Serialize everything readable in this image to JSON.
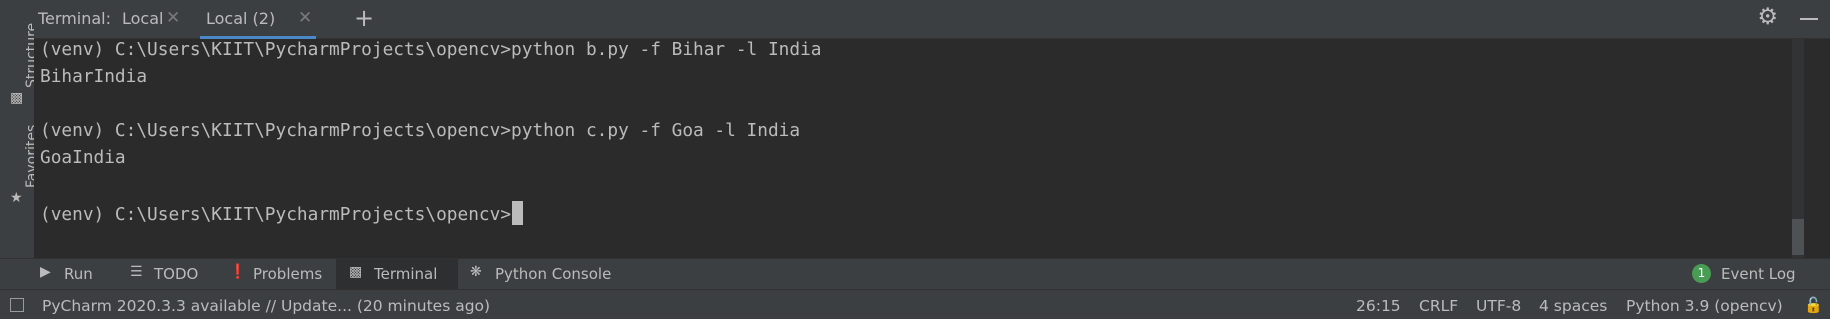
{
  "left_sidebar": {
    "structure_label": "Structure",
    "favorites_label": "Favorites"
  },
  "tab_bar": {
    "title": "Terminal:",
    "tabs": [
      {
        "label": "Local",
        "active": false
      },
      {
        "label": "Local (2)",
        "active": true
      }
    ],
    "add_tab": "+"
  },
  "terminal": {
    "lines": [
      "(venv) C:\\Users\\KIIT\\PycharmProjects\\opencv>python b.py -f Bihar -l India",
      "BiharIndia",
      "",
      "(venv) C:\\Users\\KIIT\\PycharmProjects\\opencv>python c.py -f Goa -l India",
      "GoaIndia",
      "",
      "(venv) C:\\Users\\KIIT\\PycharmProjects\\opencv>"
    ]
  },
  "tool_windows": {
    "tabs": [
      {
        "label": "Run",
        "icon": "play-icon"
      },
      {
        "label": "TODO",
        "icon": "list-icon"
      },
      {
        "label": "Problems",
        "icon": "info-icon"
      },
      {
        "label": "Terminal",
        "icon": "terminal-icon",
        "active": true
      },
      {
        "label": "Python Console",
        "icon": "python-icon"
      }
    ],
    "event_log": {
      "label": "Event Log",
      "count": "1"
    }
  },
  "status_bar": {
    "message": "PyCharm 2020.3.3 available // Update... (20 minutes ago)",
    "position": "26:15",
    "line_separator": "CRLF",
    "encoding": "UTF-8",
    "indent": "4 spaces",
    "interpreter": "Python 3.9 (opencv)"
  },
  "colors": {
    "background": "#2b2b2b",
    "panel": "#3c3f41",
    "text": "#bbbbbb",
    "accent": "#4a88c7",
    "badge": "#499c54"
  }
}
